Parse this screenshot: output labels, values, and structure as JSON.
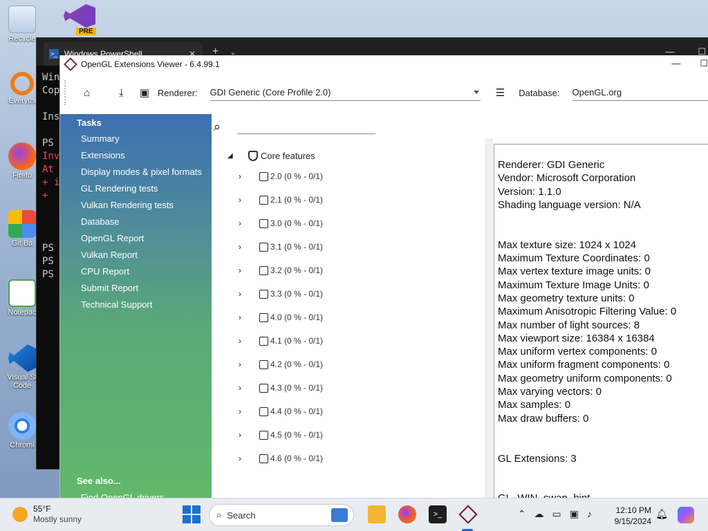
{
  "desktop": {
    "icons": [
      {
        "label": "Recycle",
        "icon": "recycle-bin-icon"
      },
      {
        "label": "Everythi",
        "icon": "everything-search-icon"
      },
      {
        "label": "Firefo",
        "icon": "firefox-icon"
      },
      {
        "label": "Git Ba",
        "icon": "git-bash-icon"
      },
      {
        "label": "Notepac",
        "icon": "notepad-icon"
      },
      {
        "label": "Visual St",
        "icon": "vscode-icon"
      },
      {
        "label": "Code",
        "icon": ""
      },
      {
        "label": "Chromi",
        "icon": "chromium-icon"
      }
    ],
    "vs_badge": "PRE"
  },
  "powershell": {
    "tab_title": "Windows PowerShell",
    "lines": [
      {
        "text": "Win",
        "color": "normal"
      },
      {
        "text": "Cop",
        "color": "normal"
      },
      {
        "text": "",
        "color": "normal"
      },
      {
        "text": "Ins",
        "color": "normal"
      },
      {
        "text": "",
        "color": "normal"
      },
      {
        "text": "PS",
        "color": "normal"
      },
      {
        "text": "Inv",
        "color": "red"
      },
      {
        "text": "At",
        "color": "red"
      },
      {
        "text": "+ i",
        "color": "red"
      },
      {
        "text": "+",
        "color": "red"
      },
      {
        "text": "",
        "color": "normal"
      },
      {
        "text": "",
        "color": "normal"
      },
      {
        "text": "",
        "color": "normal"
      },
      {
        "text": "PS",
        "color": "normal"
      },
      {
        "text": "PS",
        "color": "normal"
      },
      {
        "text": "PS",
        "color": "normal"
      }
    ]
  },
  "glviewer": {
    "title": "OpenGL Extensions Viewer - 6.4.99.1",
    "renderer_label": "Renderer:",
    "renderer_value": "GDI Generic (Core Profile 2.0)",
    "database_label": "Database:",
    "database_value": "OpenGL.org",
    "sidebar": {
      "header": "Tasks",
      "items": [
        "Summary",
        "Extensions",
        "Display modes & pixel formats",
        "GL Rendering tests",
        "Vulkan Rendering tests",
        "Database",
        "OpenGL Report",
        "Vulkan Report",
        "CPU Report",
        "Submit Report",
        "Technical Support"
      ],
      "see_also": "See also...",
      "see_also_item": "Find OpenGL drivers"
    },
    "tree": {
      "root": "Core features",
      "nodes": [
        "2.0 (0 % - 0/1)",
        "2.1 (0 % - 0/1)",
        "3.0 (0 % - 0/1)",
        "3.1 (0 % - 0/1)",
        "3.2 (0 % - 0/1)",
        "3.3 (0 % - 0/1)",
        "4.0 (0 % - 0/1)",
        "4.1 (0 % - 0/1)",
        "4.2 (0 % - 0/1)",
        "4.3 (0 % - 0/1)",
        "4.4 (0 % - 0/1)",
        "4.5 (0 % - 0/1)",
        "4.6 (0 % - 0/1)"
      ]
    },
    "info_lines": [
      "Renderer: GDI Generic",
      "Vendor: Microsoft Corporation",
      "Version: 1.1.0",
      "Shading language version: N/A",
      "",
      "",
      "Max texture size: 1024 x 1024",
      "Maximum Texture Coordinates: 0",
      "Max vertex texture image units: 0",
      "Maximum Texture Image Units: 0",
      "Max geometry texture units: 0",
      "Maximum Anisotropic Filtering Value: 0",
      "Max number of light sources: 8",
      "Max viewport size: 16384 x 16384",
      "Max uniform vertex components: 0",
      "Max uniform fragment components: 0",
      "Max geometry uniform components: 0",
      "Max varying vectors: 0",
      "Max samples: 0",
      "Max draw buffers: 0",
      "",
      "",
      "GL Extensions: 3",
      "",
      "",
      "GL_WIN_swap_hint"
    ]
  },
  "taskbar": {
    "temperature": "55°F",
    "weather": "Mostly sunny",
    "search_placeholder": "Search",
    "time": "12:10 PM",
    "date": "9/15/2024"
  }
}
